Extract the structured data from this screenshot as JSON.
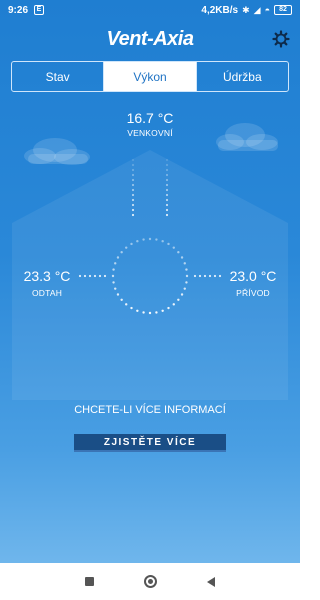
{
  "status_bar": {
    "time": "9:26",
    "app_icon": "E",
    "network_speed": "4,2KB/s",
    "battery": "82",
    "icons": [
      "bluetooth-icon",
      "signal-icon",
      "wifi-icon",
      "battery-icon"
    ]
  },
  "header": {
    "logo": "Vent-Axia",
    "settings_icon": "gear-icon"
  },
  "tabs": [
    {
      "label": "Stav",
      "active": false
    },
    {
      "label": "Výkon",
      "active": true
    },
    {
      "label": "Údržba",
      "active": false
    }
  ],
  "readings": {
    "outdoor": {
      "value": "16.7 °C",
      "label": "VENKOVNÍ"
    },
    "extract": {
      "value": "23.3 °C",
      "label": "ODTAH"
    },
    "supply": {
      "value": "23.0 °C",
      "label": "PŘÍVOD"
    }
  },
  "info": {
    "text": "CHCETE-LI VÍCE INFORMACÍ",
    "button_label": "ZJISTĚTE VÍCE"
  },
  "colors": {
    "background_top": "#1f7ed1",
    "background_bottom": "#6fb6ec",
    "button": "#1a4e86",
    "active_tab_text": "#1f73c4"
  },
  "nav": {
    "recent": "square-icon",
    "home": "circle-icon",
    "back": "triangle-back-icon"
  }
}
